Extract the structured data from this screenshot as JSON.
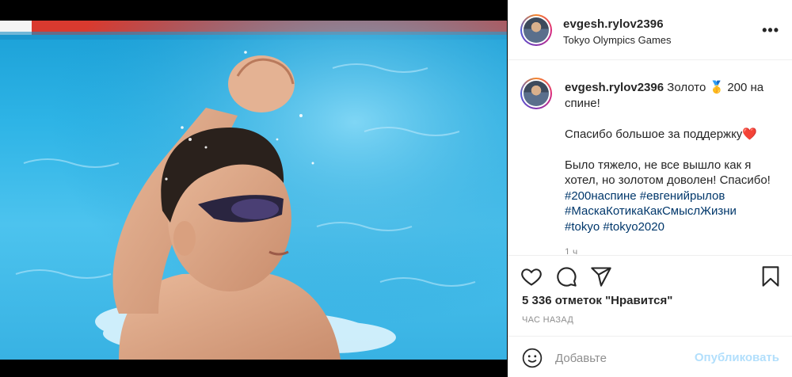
{
  "header": {
    "username": "evgesh.rylov2396",
    "location": "Tokyo Olympics Games",
    "more_label": "•••"
  },
  "caption": {
    "username": "evgesh.rylov2396",
    "line1": "Золото 🥇 200 на спине!",
    "line2": "Спасибо большое за поддержку❤️",
    "line3": "Было тяжело, не все вышло как я хотел, но золотом доволен! Спасибо!",
    "hashtags": [
      "#200наспине",
      "#евгенийрылов",
      "#МаскаКотикаКакСмыслЖизни",
      "#tokyo",
      "#tokyo2020"
    ],
    "time_short": "1 ч"
  },
  "actions": {
    "icons": [
      "heart-icon",
      "comment-icon",
      "share-icon",
      "bookmark-icon"
    ]
  },
  "likes": "5 336 отметок \"Нравится\"",
  "time_ago": "ЧАС НАЗАД",
  "comment": {
    "placeholder": "Добавьте",
    "publish_label": "Опубликовать"
  },
  "colors": {
    "accent_link": "#00376b",
    "publish_disabled": "#b2dffc",
    "muted": "#8e8e8e",
    "water": "#2eb4e6"
  }
}
